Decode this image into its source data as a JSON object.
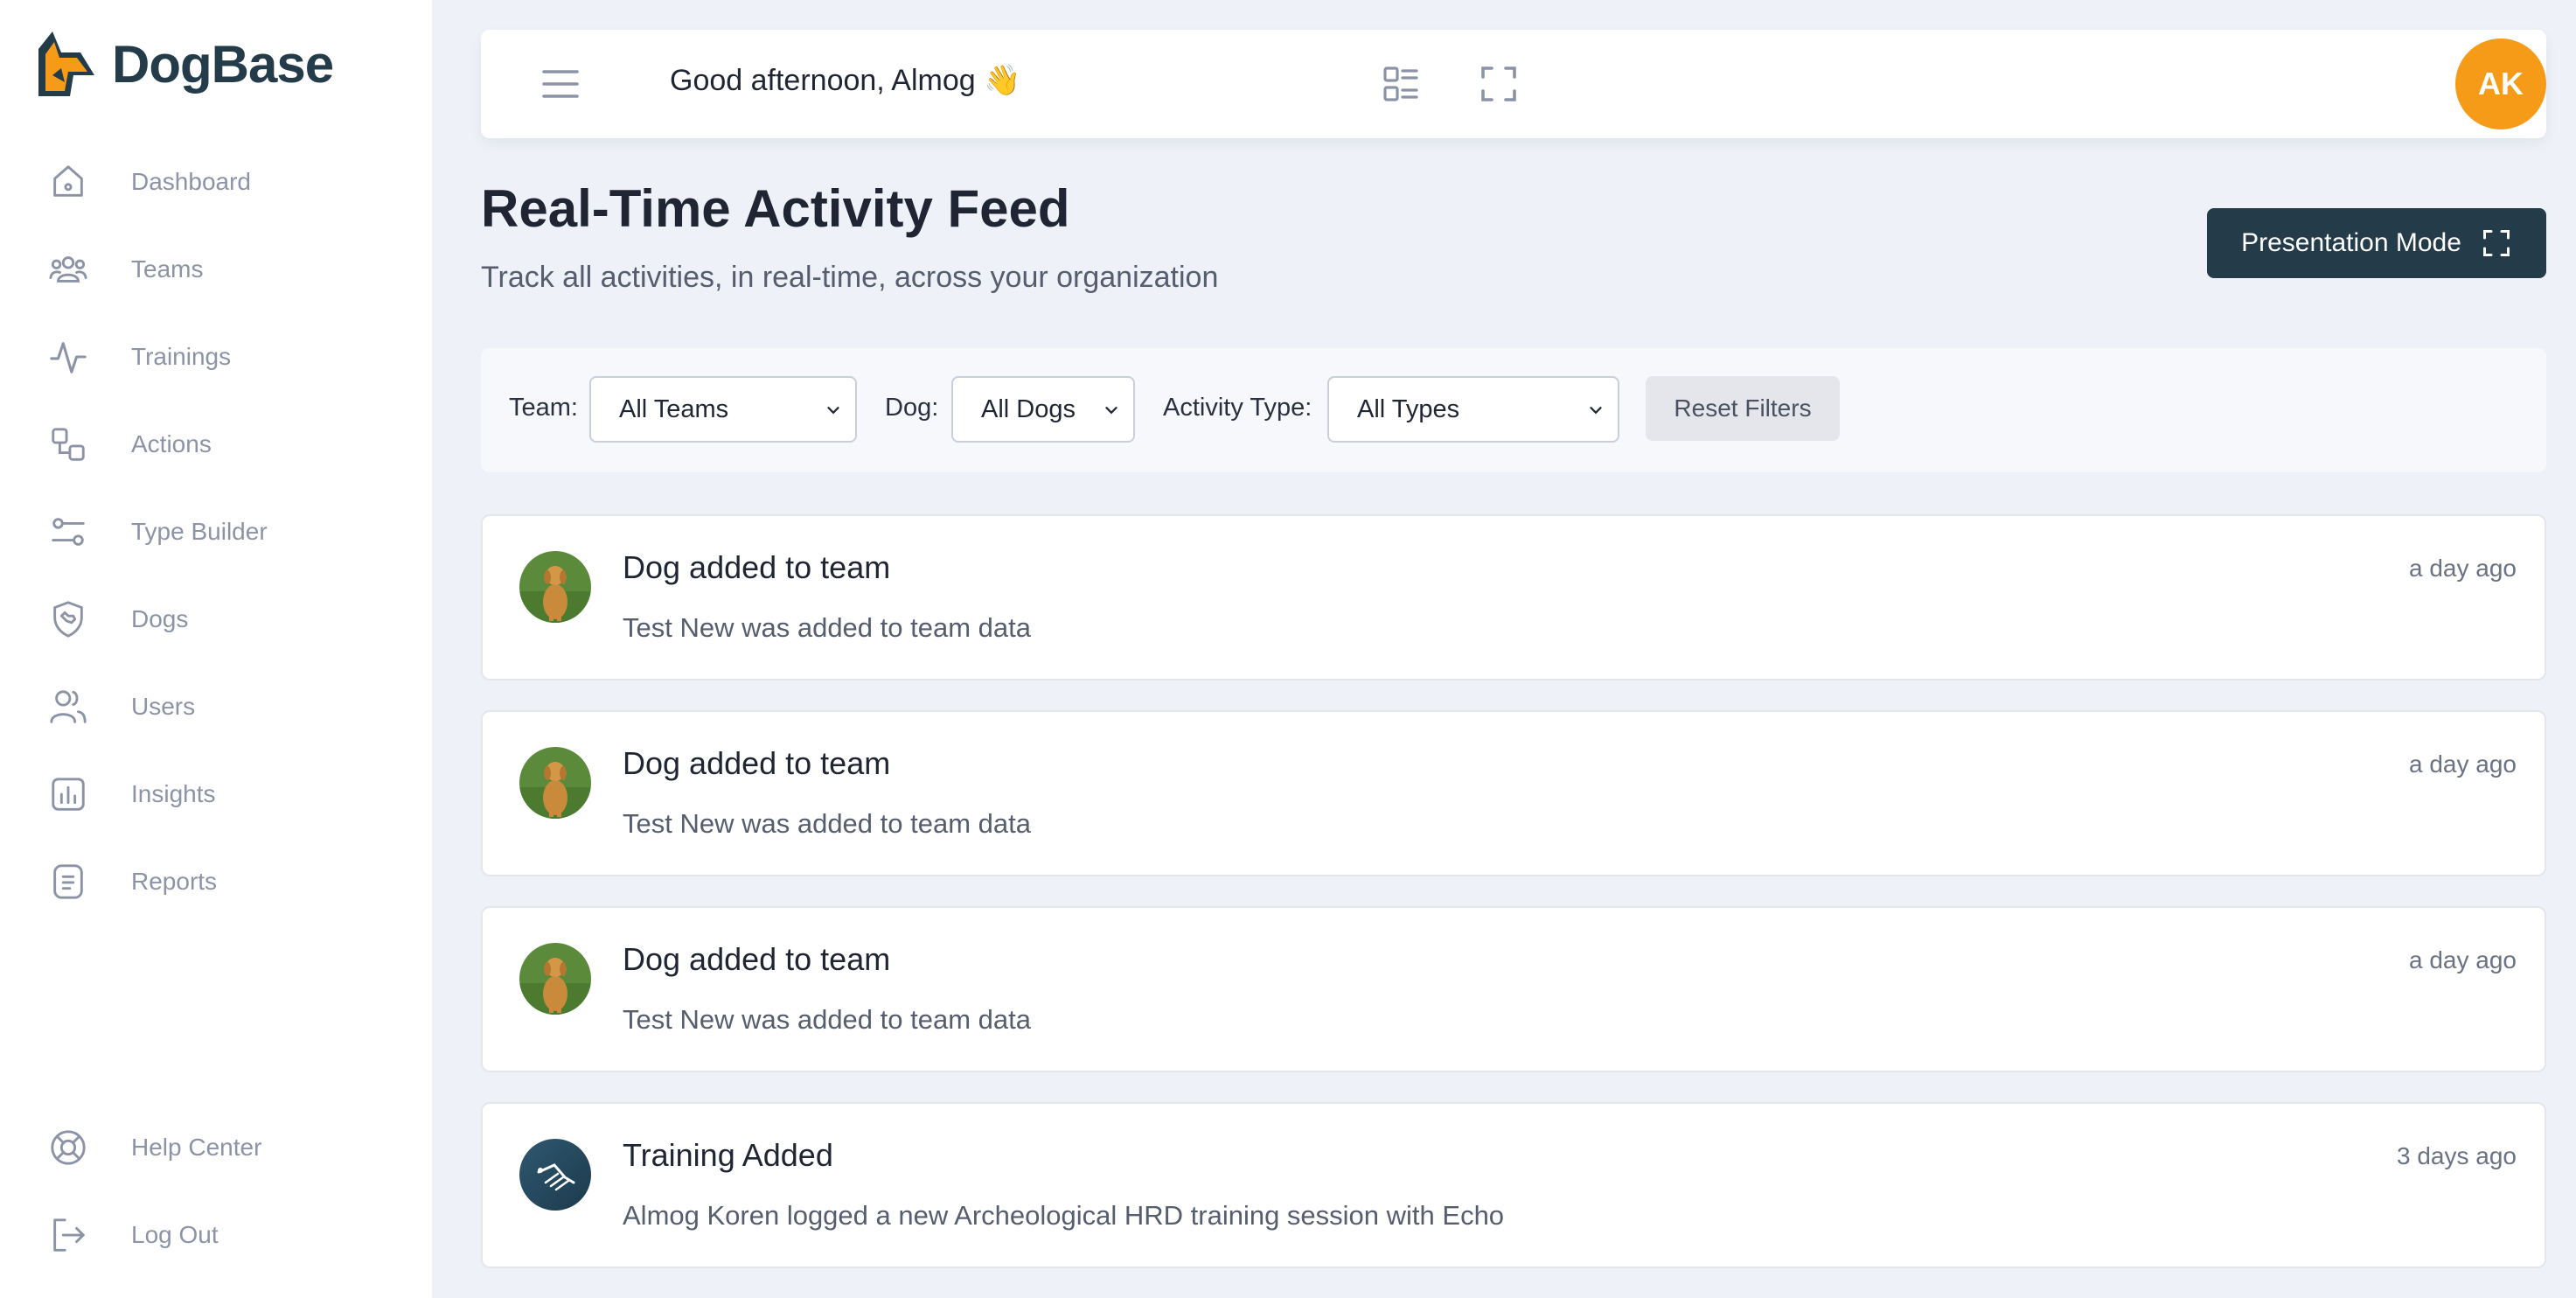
{
  "app": {
    "name": "DogBase"
  },
  "sidebar": {
    "items": [
      {
        "label": "Dashboard",
        "icon": "home-icon"
      },
      {
        "label": "Teams",
        "icon": "users-group-icon"
      },
      {
        "label": "Trainings",
        "icon": "activity-icon"
      },
      {
        "label": "Actions",
        "icon": "shapes-icon"
      },
      {
        "label": "Type Builder",
        "icon": "sliders-icon"
      },
      {
        "label": "Dogs",
        "icon": "shield-dog-icon"
      },
      {
        "label": "Users",
        "icon": "users-icon"
      },
      {
        "label": "Insights",
        "icon": "bar-chart-icon"
      },
      {
        "label": "Reports",
        "icon": "report-icon"
      }
    ],
    "bottom_items": [
      {
        "label": "Help Center",
        "icon": "lifebuoy-icon"
      },
      {
        "label": "Log Out",
        "icon": "logout-icon"
      }
    ]
  },
  "header": {
    "greeting": "Good afternoon, Almog",
    "greeting_emoji": "👋",
    "avatar_initials": "AK",
    "avatar_color": "#f59b17"
  },
  "page": {
    "title": "Real-Time Activity Feed",
    "subtitle": "Track all activities, in real-time, across your organization",
    "presentation_button": "Presentation Mode"
  },
  "filters": {
    "team_label": "Team:",
    "team_value": "All Teams",
    "dog_label": "Dog:",
    "dog_value": "All Dogs",
    "type_label": "Activity Type:",
    "type_value": "All Types",
    "reset_label": "Reset Filters"
  },
  "feed": [
    {
      "title": "Dog added to team",
      "description": "Test New was added to team data",
      "time": "a day ago",
      "avatar": "dog-photo"
    },
    {
      "title": "Dog added to team",
      "description": "Test New was added to team data",
      "time": "a day ago",
      "avatar": "dog-photo"
    },
    {
      "title": "Dog added to team",
      "description": "Test New was added to team data",
      "time": "a day ago",
      "avatar": "dog-photo"
    },
    {
      "title": "Training Added",
      "description": "Almog Koren logged a new Archeological HRD training session with Echo",
      "time": "3 days ago",
      "avatar": "training-icon"
    }
  ],
  "colors": {
    "brand_dark": "#243b4a",
    "brand_orange": "#f59b17",
    "background": "#eef1f7"
  }
}
